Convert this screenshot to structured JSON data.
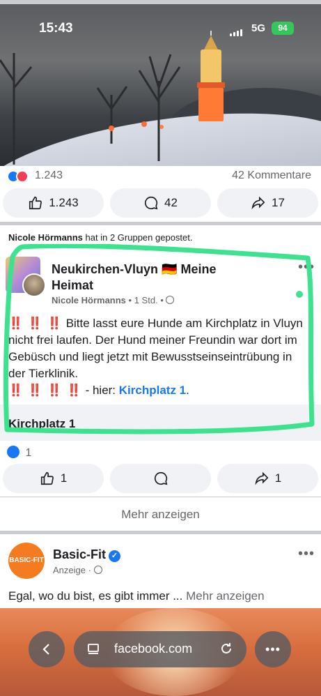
{
  "status": {
    "time": "15:43",
    "network": "5G",
    "battery": "94"
  },
  "post1": {
    "reactions_count": "1.243",
    "comments_label": "42 Kommentare",
    "actions": {
      "like": "1.243",
      "comment": "42",
      "share": "17"
    }
  },
  "post2": {
    "shared_by": "Nicole Hörmanns",
    "shared_suffix": "hat in 2 Gruppen gepostet.",
    "group_title": "Neukirchen-Vluyn 🇩🇪 Meine Heimat",
    "author": "Nicole Hörmanns",
    "time": "1 Std.",
    "text_bangs_start": "‼️ ‼️ ‼️",
    "text_body": "Bitte lasst eure Hunde am Kirchplatz in Vluyn nicht frei laufen. Der Hund meiner Freundin war dort im Gebüsch und liegt jetzt mit Bewusstseinseintrübung in der Tierklinik.",
    "text_bangs_end": "‼️ ‼️ ‼️ ‼️",
    "text_here": "- hier:",
    "location_link": "Kirchplatz 1",
    "location_period": ".",
    "link_card_title": "Kirchplatz 1",
    "reactions_count": "1",
    "actions": {
      "like": "1",
      "share": "1"
    },
    "highlight_color": "#3de28f"
  },
  "more_button": "Mehr anzeigen",
  "ad": {
    "logo_text": "BASIC-FIT",
    "name": "Basic-Fit",
    "label": "Anzeige",
    "text": "Egal, wo du bist, es gibt immer ...",
    "more": "Mehr anzeigen"
  },
  "browser": {
    "url": "facebook.com"
  },
  "colors": {
    "brand": "#1877f2",
    "bang": "#e0201f",
    "basicfit": "#f57b20"
  }
}
